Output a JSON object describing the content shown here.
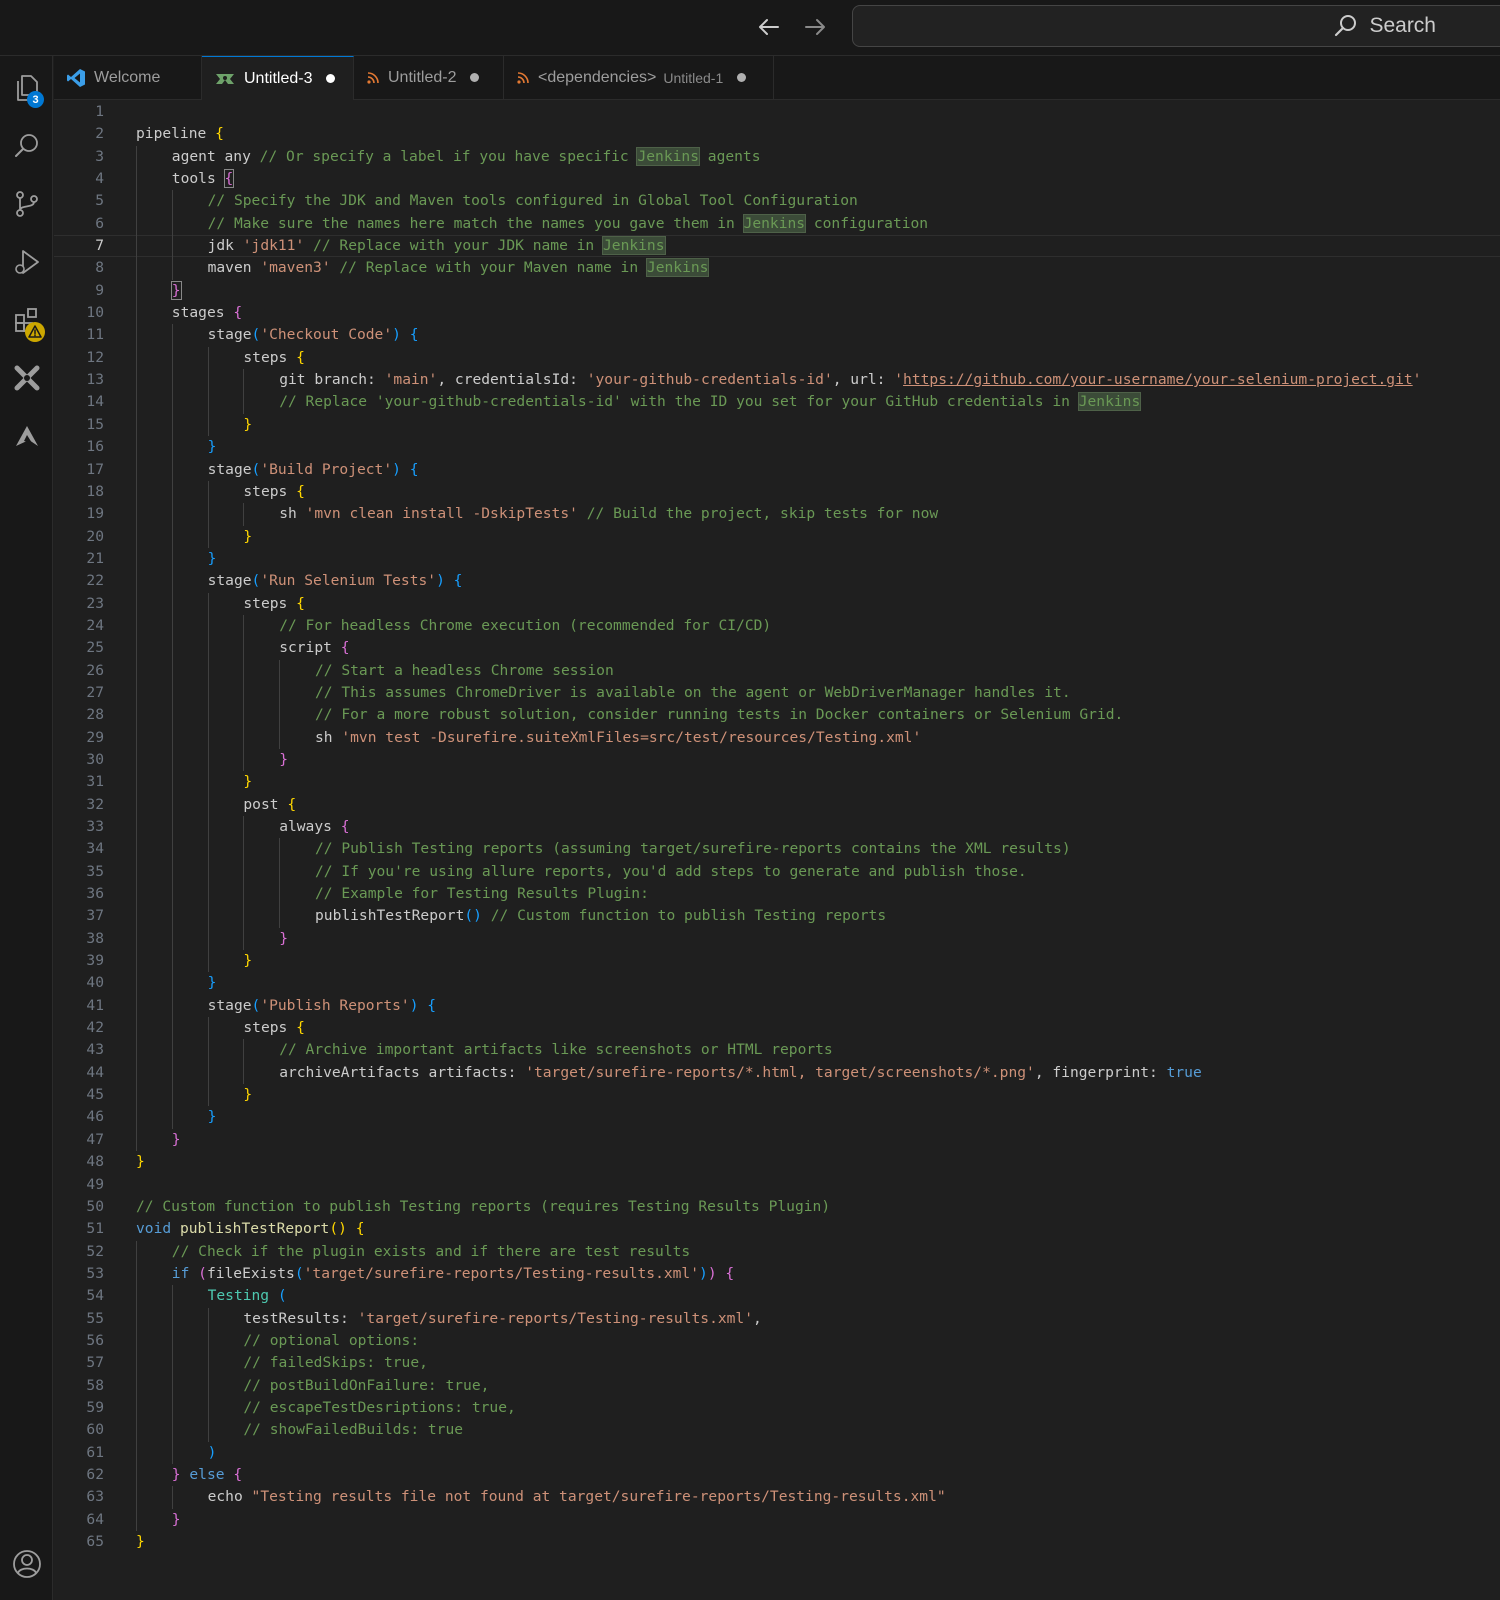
{
  "titlebar": {
    "back_icon": "arrow-left-icon",
    "forward_icon": "arrow-right-icon",
    "search_label": "Search"
  },
  "activitybar": {
    "explorer_badge": "3",
    "items": [
      "explorer-icon",
      "search-icon",
      "source-control-icon",
      "run-debug-icon",
      "extensions-icon",
      "x-extension-icon",
      "a-extension-icon",
      "account-icon"
    ]
  },
  "tabs": [
    {
      "label": "Welcome",
      "description": "",
      "dirty": false,
      "active": false,
      "icon": "vscode-icon"
    },
    {
      "label": "Untitled-3",
      "description": "",
      "dirty": true,
      "active": true,
      "icon": "groovy-icon"
    },
    {
      "label": "Untitled-2",
      "description": "",
      "dirty": true,
      "active": false,
      "icon": "rss-icon"
    },
    {
      "label": "<dependencies>",
      "description": "Untitled-1",
      "dirty": true,
      "active": false,
      "icon": "rss-icon"
    }
  ],
  "editor": {
    "current_line": 7,
    "lines": [
      {
        "n": "1",
        "indent": 0,
        "tokens": []
      },
      {
        "n": "2",
        "indent": 0,
        "tokens": [
          [
            "t",
            "pipeline "
          ],
          [
            "b1",
            "{"
          ]
        ]
      },
      {
        "n": "3",
        "indent": 1,
        "tokens": [
          [
            "t",
            "agent any "
          ],
          [
            "cm",
            "// Or specify a label if you have specific "
          ],
          [
            "hl",
            "Jenkins"
          ],
          [
            "cm",
            " agents"
          ]
        ]
      },
      {
        "n": "4",
        "indent": 1,
        "tokens": [
          [
            "t",
            "tools "
          ],
          [
            "bm",
            "{"
          ]
        ]
      },
      {
        "n": "5",
        "indent": 2,
        "tokens": [
          [
            "cm",
            "// Specify the JDK and Maven tools configured in Global Tool Configuration"
          ]
        ]
      },
      {
        "n": "6",
        "indent": 2,
        "tokens": [
          [
            "cm",
            "// Make sure the names here match the names you gave them in "
          ],
          [
            "hl",
            "Jenkins"
          ],
          [
            "cm",
            " configuration"
          ]
        ]
      },
      {
        "n": "7",
        "indent": 2,
        "tokens": [
          [
            "t",
            "jdk "
          ],
          [
            "str",
            "'jdk11'"
          ],
          [
            "cm",
            " // Replace with your JDK name in "
          ],
          [
            "hl",
            "Jenkins"
          ]
        ]
      },
      {
        "n": "8",
        "indent": 2,
        "tokens": [
          [
            "t",
            "maven "
          ],
          [
            "str",
            "'maven3'"
          ],
          [
            "cm",
            " // Replace with your Maven name in "
          ],
          [
            "hl",
            "Jenkins"
          ]
        ]
      },
      {
        "n": "9",
        "indent": 1,
        "tokens": [
          [
            "bm",
            "}"
          ]
        ]
      },
      {
        "n": "10",
        "indent": 1,
        "tokens": [
          [
            "t",
            "stages "
          ],
          [
            "b2",
            "{"
          ]
        ]
      },
      {
        "n": "11",
        "indent": 2,
        "tokens": [
          [
            "t",
            "stage"
          ],
          [
            "b3",
            "("
          ],
          [
            "str",
            "'Checkout Code'"
          ],
          [
            "b3",
            ")"
          ],
          [
            "t",
            " "
          ],
          [
            "b3",
            "{"
          ]
        ]
      },
      {
        "n": "12",
        "indent": 3,
        "tokens": [
          [
            "t",
            "steps "
          ],
          [
            "b1",
            "{"
          ]
        ]
      },
      {
        "n": "13",
        "indent": 4,
        "tokens": [
          [
            "t",
            "git branch: "
          ],
          [
            "str",
            "'main'"
          ],
          [
            "t",
            ", credentialsId: "
          ],
          [
            "str",
            "'your-github-credentials-id'"
          ],
          [
            "t",
            ", url: "
          ],
          [
            "str",
            "'"
          ],
          [
            "url",
            "https://github.com/your-username/your-selenium-project.git"
          ],
          [
            "str",
            "'"
          ]
        ]
      },
      {
        "n": "14",
        "indent": 4,
        "tokens": [
          [
            "cm",
            "// Replace 'your-github-credentials-id' with the ID you set for your GitHub credentials in "
          ],
          [
            "hl",
            "Jenkins"
          ]
        ]
      },
      {
        "n": "15",
        "indent": 3,
        "tokens": [
          [
            "b1",
            "}"
          ]
        ]
      },
      {
        "n": "16",
        "indent": 2,
        "tokens": [
          [
            "b3",
            "}"
          ]
        ]
      },
      {
        "n": "17",
        "indent": 2,
        "tokens": [
          [
            "t",
            "stage"
          ],
          [
            "b3",
            "("
          ],
          [
            "str",
            "'Build Project'"
          ],
          [
            "b3",
            ")"
          ],
          [
            "t",
            " "
          ],
          [
            "b3",
            "{"
          ]
        ]
      },
      {
        "n": "18",
        "indent": 3,
        "tokens": [
          [
            "t",
            "steps "
          ],
          [
            "b1",
            "{"
          ]
        ]
      },
      {
        "n": "19",
        "indent": 4,
        "tokens": [
          [
            "t",
            "sh "
          ],
          [
            "str",
            "'mvn clean install -DskipTests'"
          ],
          [
            "cm",
            " // Build the project, skip tests for now"
          ]
        ]
      },
      {
        "n": "20",
        "indent": 3,
        "tokens": [
          [
            "b1",
            "}"
          ]
        ]
      },
      {
        "n": "21",
        "indent": 2,
        "tokens": [
          [
            "b3",
            "}"
          ]
        ]
      },
      {
        "n": "22",
        "indent": 2,
        "tokens": [
          [
            "t",
            "stage"
          ],
          [
            "b3",
            "("
          ],
          [
            "str",
            "'Run Selenium Tests'"
          ],
          [
            "b3",
            ")"
          ],
          [
            "t",
            " "
          ],
          [
            "b3",
            "{"
          ]
        ]
      },
      {
        "n": "23",
        "indent": 3,
        "tokens": [
          [
            "t",
            "steps "
          ],
          [
            "b1",
            "{"
          ]
        ]
      },
      {
        "n": "24",
        "indent": 4,
        "tokens": [
          [
            "cm",
            "// For headless Chrome execution (recommended for CI/CD)"
          ]
        ]
      },
      {
        "n": "25",
        "indent": 4,
        "tokens": [
          [
            "t",
            "script "
          ],
          [
            "b2",
            "{"
          ]
        ]
      },
      {
        "n": "26",
        "indent": 5,
        "tokens": [
          [
            "cm",
            "// Start a headless Chrome session"
          ]
        ]
      },
      {
        "n": "27",
        "indent": 5,
        "tokens": [
          [
            "cm",
            "// This assumes ChromeDriver is available on the agent or WebDriverManager handles it."
          ]
        ]
      },
      {
        "n": "28",
        "indent": 5,
        "tokens": [
          [
            "cm",
            "// For a more robust solution, consider running tests in Docker containers or Selenium Grid."
          ]
        ]
      },
      {
        "n": "29",
        "indent": 5,
        "tokens": [
          [
            "t",
            "sh "
          ],
          [
            "str",
            "'mvn test -Dsurefire.suiteXmlFiles=src/test/resources/Testing.xml'"
          ]
        ]
      },
      {
        "n": "30",
        "indent": 4,
        "tokens": [
          [
            "b2",
            "}"
          ]
        ]
      },
      {
        "n": "31",
        "indent": 3,
        "tokens": [
          [
            "b1",
            "}"
          ]
        ]
      },
      {
        "n": "32",
        "indent": 3,
        "tokens": [
          [
            "t",
            "post "
          ],
          [
            "b1",
            "{"
          ]
        ]
      },
      {
        "n": "33",
        "indent": 4,
        "tokens": [
          [
            "t",
            "always "
          ],
          [
            "b2",
            "{"
          ]
        ]
      },
      {
        "n": "34",
        "indent": 5,
        "tokens": [
          [
            "cm",
            "// Publish Testing reports (assuming target/surefire-reports contains the XML results)"
          ]
        ]
      },
      {
        "n": "35",
        "indent": 5,
        "tokens": [
          [
            "cm",
            "// If you're using allure reports, you'd add steps to generate and publish those."
          ]
        ]
      },
      {
        "n": "36",
        "indent": 5,
        "tokens": [
          [
            "cm",
            "// Example for Testing Results Plugin:"
          ]
        ]
      },
      {
        "n": "37",
        "indent": 5,
        "tokens": [
          [
            "t",
            "publishTestReport"
          ],
          [
            "b3",
            "()"
          ],
          [
            "cm",
            " // Custom function to publish Testing reports"
          ]
        ]
      },
      {
        "n": "38",
        "indent": 4,
        "tokens": [
          [
            "b2",
            "}"
          ]
        ]
      },
      {
        "n": "39",
        "indent": 3,
        "tokens": [
          [
            "b1",
            "}"
          ]
        ]
      },
      {
        "n": "40",
        "indent": 2,
        "tokens": [
          [
            "b3",
            "}"
          ]
        ]
      },
      {
        "n": "41",
        "indent": 2,
        "tokens": [
          [
            "t",
            "stage"
          ],
          [
            "b3",
            "("
          ],
          [
            "str",
            "'Publish Reports'"
          ],
          [
            "b3",
            ")"
          ],
          [
            "t",
            " "
          ],
          [
            "b3",
            "{"
          ]
        ]
      },
      {
        "n": "42",
        "indent": 3,
        "tokens": [
          [
            "t",
            "steps "
          ],
          [
            "b1",
            "{"
          ]
        ]
      },
      {
        "n": "43",
        "indent": 4,
        "tokens": [
          [
            "cm",
            "// Archive important artifacts like screenshots or HTML reports"
          ]
        ]
      },
      {
        "n": "44",
        "indent": 4,
        "tokens": [
          [
            "t",
            "archiveArtifacts artifacts: "
          ],
          [
            "str",
            "'target/surefire-reports/*.html, target/screenshots/*.png'"
          ],
          [
            "t",
            ", fingerprint: "
          ],
          [
            "kw",
            "true"
          ]
        ]
      },
      {
        "n": "45",
        "indent": 3,
        "tokens": [
          [
            "b1",
            "}"
          ]
        ]
      },
      {
        "n": "46",
        "indent": 2,
        "tokens": [
          [
            "b3",
            "}"
          ]
        ]
      },
      {
        "n": "47",
        "indent": 1,
        "tokens": [
          [
            "b2",
            "}"
          ]
        ]
      },
      {
        "n": "48",
        "indent": 0,
        "tokens": [
          [
            "b1",
            "}"
          ]
        ]
      },
      {
        "n": "49",
        "indent": 0,
        "tokens": []
      },
      {
        "n": "50",
        "indent": 0,
        "tokens": [
          [
            "cm",
            "// Custom function to publish Testing reports (requires Testing Results Plugin)"
          ]
        ]
      },
      {
        "n": "51",
        "indent": 0,
        "tokens": [
          [
            "kw",
            "void "
          ],
          [
            "fn",
            "publishTestReport"
          ],
          [
            "b1",
            "()"
          ],
          [
            "t",
            " "
          ],
          [
            "b1",
            "{"
          ]
        ]
      },
      {
        "n": "52",
        "indent": 1,
        "tokens": [
          [
            "cm",
            "// Check if the plugin exists and if there are test results"
          ]
        ]
      },
      {
        "n": "53",
        "indent": 1,
        "tokens": [
          [
            "kw",
            "if "
          ],
          [
            "b2",
            "("
          ],
          [
            "t",
            "fileExists"
          ],
          [
            "b3",
            "("
          ],
          [
            "str",
            "'target/surefire-reports/Testing-results.xml'"
          ],
          [
            "b3",
            ")"
          ],
          [
            "b2",
            ")"
          ],
          [
            "t",
            " "
          ],
          [
            "b2",
            "{"
          ]
        ]
      },
      {
        "n": "54",
        "indent": 2,
        "tokens": [
          [
            "ty",
            "Testing "
          ],
          [
            "b3",
            "("
          ]
        ]
      },
      {
        "n": "55",
        "indent": 3,
        "tokens": [
          [
            "t",
            "testResults: "
          ],
          [
            "str",
            "'target/surefire-reports/Testing-results.xml'"
          ],
          [
            "t",
            ","
          ]
        ]
      },
      {
        "n": "56",
        "indent": 3,
        "tokens": [
          [
            "cm",
            "// optional options:"
          ]
        ]
      },
      {
        "n": "57",
        "indent": 3,
        "tokens": [
          [
            "cm",
            "// failedSkips: true,"
          ]
        ]
      },
      {
        "n": "58",
        "indent": 3,
        "tokens": [
          [
            "cm",
            "// postBuildOnFailure: true,"
          ]
        ]
      },
      {
        "n": "59",
        "indent": 3,
        "tokens": [
          [
            "cm",
            "// escapeTestDesriptions: true,"
          ]
        ]
      },
      {
        "n": "60",
        "indent": 3,
        "tokens": [
          [
            "cm",
            "// showFailedBuilds: true"
          ]
        ]
      },
      {
        "n": "61",
        "indent": 2,
        "tokens": [
          [
            "b3",
            ")"
          ]
        ]
      },
      {
        "n": "62",
        "indent": 1,
        "tokens": [
          [
            "b2",
            "}"
          ],
          [
            "kw",
            " else "
          ],
          [
            "b2",
            "{"
          ]
        ]
      },
      {
        "n": "63",
        "indent": 2,
        "tokens": [
          [
            "t",
            "echo "
          ],
          [
            "str",
            "\"Testing results file not found at target/surefire-reports/Testing-results.xml\""
          ]
        ]
      },
      {
        "n": "64",
        "indent": 1,
        "tokens": [
          [
            "b2",
            "}"
          ]
        ]
      },
      {
        "n": "65",
        "indent": 0,
        "tokens": [
          [
            "b1",
            "}"
          ]
        ]
      }
    ]
  }
}
